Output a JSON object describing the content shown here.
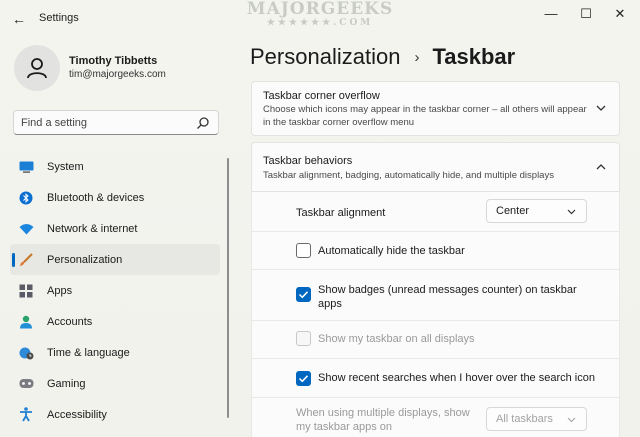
{
  "window": {
    "title": "Settings",
    "back_glyph": "←",
    "minimize_glyph": "—",
    "maximize_glyph": "☐",
    "close_glyph": "✕"
  },
  "watermark": {
    "main": "MAJORGEEKS",
    "sub": "★★★★★★.COM"
  },
  "profile": {
    "name": "Timothy Tibbetts",
    "email": "tim@majorgeeks.com",
    "icon": "person-icon"
  },
  "search": {
    "placeholder": "Find a setting",
    "value": "",
    "icon": "search-icon"
  },
  "sidebar": {
    "items": [
      {
        "label": "System",
        "icon": "system-icon",
        "active": false
      },
      {
        "label": "Bluetooth & devices",
        "icon": "bluetooth-icon",
        "active": false
      },
      {
        "label": "Network & internet",
        "icon": "wifi-icon",
        "active": false
      },
      {
        "label": "Personalization",
        "icon": "brush-icon",
        "active": true
      },
      {
        "label": "Apps",
        "icon": "apps-icon",
        "active": false
      },
      {
        "label": "Accounts",
        "icon": "accounts-icon",
        "active": false
      },
      {
        "label": "Time & language",
        "icon": "globe-clock-icon",
        "active": false
      },
      {
        "label": "Gaming",
        "icon": "gamepad-icon",
        "active": false
      },
      {
        "label": "Accessibility",
        "icon": "accessibility-icon",
        "active": false
      }
    ]
  },
  "breadcrumb": {
    "parent": "Personalization",
    "separator": "›",
    "current": "Taskbar"
  },
  "overflow_card": {
    "title": "Taskbar corner overflow",
    "description": "Choose which icons may appear in the taskbar corner – all others will appear in the taskbar corner overflow menu"
  },
  "behaviors_card": {
    "title": "Taskbar behaviors",
    "description": "Taskbar alignment, badging, automatically hide, and multiple displays"
  },
  "settings": {
    "alignment_label": "Taskbar alignment",
    "alignment_value": "Center",
    "auto_hide_label": "Automatically hide the taskbar",
    "auto_hide_checked": false,
    "badges_label": "Show badges (unread messages counter) on taskbar apps",
    "badges_checked": true,
    "all_displays_label": "Show my taskbar on all displays",
    "all_displays_checked": false,
    "recent_searches_label": "Show recent searches when I hover over the search icon",
    "recent_searches_checked": true,
    "multi_display_label": "When using multiple displays, show my taskbar apps on",
    "multi_display_value": "All taskbars"
  },
  "colors": {
    "accent": "#0067c0"
  }
}
